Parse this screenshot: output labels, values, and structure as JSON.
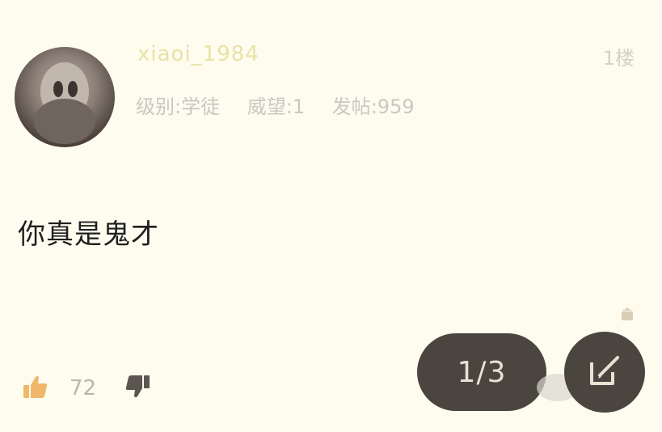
{
  "post": {
    "username": "xiaoi_1984",
    "floor": "1楼",
    "level": "级别:学徒",
    "reputation": "威望:1",
    "posts": "发帖:959",
    "content": "你真是鬼才"
  },
  "actions": {
    "like_count": "72",
    "pager": "1/3"
  },
  "icons": {
    "like": "thumbs-up-icon",
    "dislike": "thumbs-down-icon",
    "edit": "edit-icon",
    "android": "android-icon"
  },
  "colors": {
    "background": "#fdfcef",
    "button": "#4a463f",
    "like": "#f0b76a"
  }
}
